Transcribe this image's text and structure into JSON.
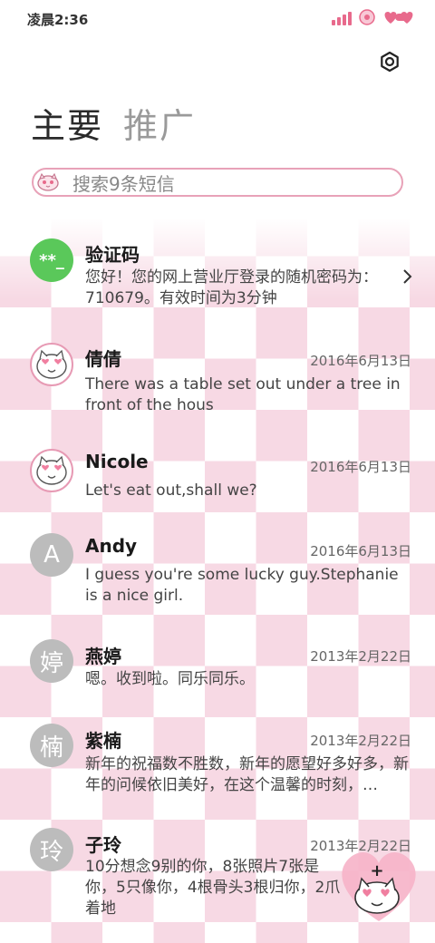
{
  "status": {
    "time": "凌晨2:36"
  },
  "tabs": [
    {
      "label": "主要"
    },
    {
      "label": "推广"
    }
  ],
  "search": {
    "placeholder": "搜索9条短信"
  },
  "conversations": [
    {
      "name": "验证码",
      "avatar_text": "**_",
      "date": "",
      "message": "您好！您的网上营业厅登录的随机密码为：710679。有效时间为3分钟"
    },
    {
      "name": "倩倩",
      "avatar_text": "",
      "date": "2016年6月13日",
      "message": "There was a table set out under a tree in front of the hous"
    },
    {
      "name": "Nicole",
      "avatar_text": "",
      "date": "2016年6月13日",
      "message": "Let's eat out,shall we?"
    },
    {
      "name": "Andy",
      "avatar_text": "A",
      "date": "2016年6月13日",
      "message": "I guess you're some lucky guy.Stephanie is a nice girl."
    },
    {
      "name": "燕婷",
      "avatar_text": "婷",
      "date": "2013年2月22日",
      "message": "嗯。收到啦。同乐同乐。"
    },
    {
      "name": "紫楠",
      "avatar_text": "楠",
      "date": "2013年2月22日",
      "message": "新年的祝福数不胜数，新年的愿望好多好多，新年的问候依旧美好，在这个温馨的时刻，…"
    },
    {
      "name": "子玲",
      "avatar_text": "玲",
      "date": "2013年2月22日",
      "message": "10分想念9别的你，8张照片7张是你，5只像你，4根骨头3根归你，2爪着地"
    }
  ],
  "fab": {
    "symbol": "+"
  },
  "colors": {
    "accent": "#e86a8c",
    "pattern": "#f7d9e4",
    "green_avatar": "#5ac85a",
    "gray_avatar": "#bcbcbc"
  }
}
